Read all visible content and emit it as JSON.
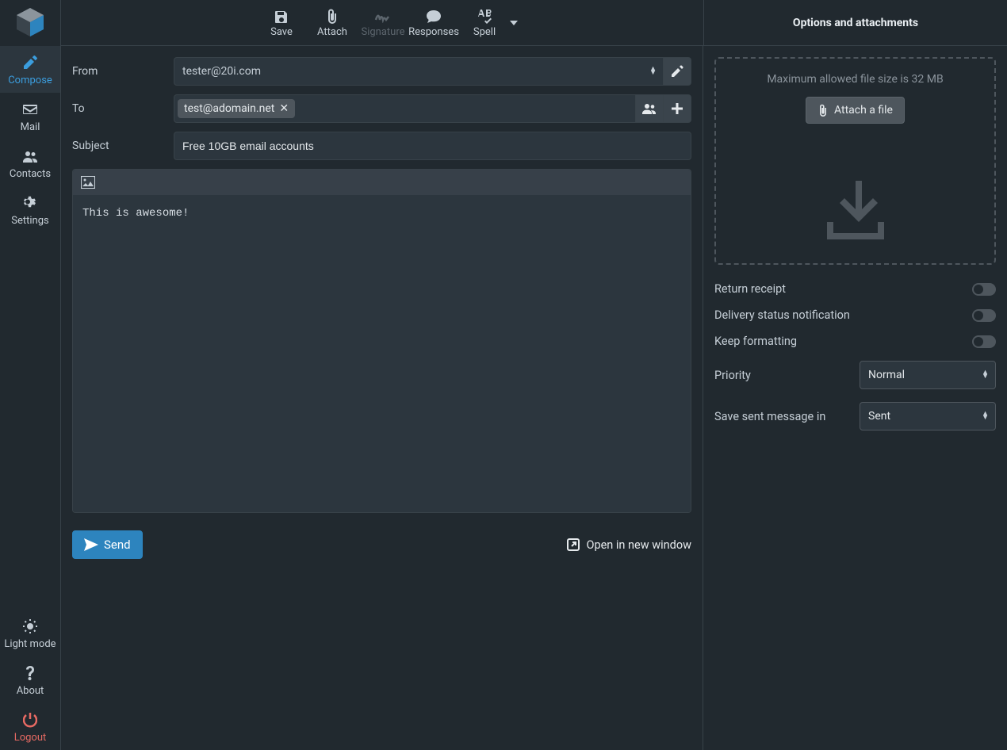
{
  "sidebar": {
    "items": [
      {
        "label": "Compose"
      },
      {
        "label": "Mail"
      },
      {
        "label": "Contacts"
      },
      {
        "label": "Settings"
      }
    ],
    "bottom": [
      {
        "label": "Light mode"
      },
      {
        "label": "About"
      },
      {
        "label": "Logout"
      }
    ]
  },
  "toolbar": {
    "save": "Save",
    "attach": "Attach",
    "signature": "Signature",
    "responses": "Responses",
    "spell": "Spell"
  },
  "options_header": "Options and attachments",
  "compose": {
    "from_label": "From",
    "from_value": "tester@20i.com",
    "to_label": "To",
    "to_chip": "test@adomain.net",
    "subject_label": "Subject",
    "subject_value": "Free 10GB email accounts",
    "body": "This is awesome!",
    "send": "Send",
    "open_window": "Open in new window"
  },
  "options": {
    "dropzone_text": "Maximum allowed file size is 32 MB",
    "attach_file": "Attach a file",
    "return_receipt": "Return receipt",
    "delivery_status": "Delivery status notification",
    "keep_formatting": "Keep formatting",
    "priority_label": "Priority",
    "priority_value": "Normal",
    "save_sent_label": "Save sent message in",
    "save_sent_value": "Sent"
  }
}
